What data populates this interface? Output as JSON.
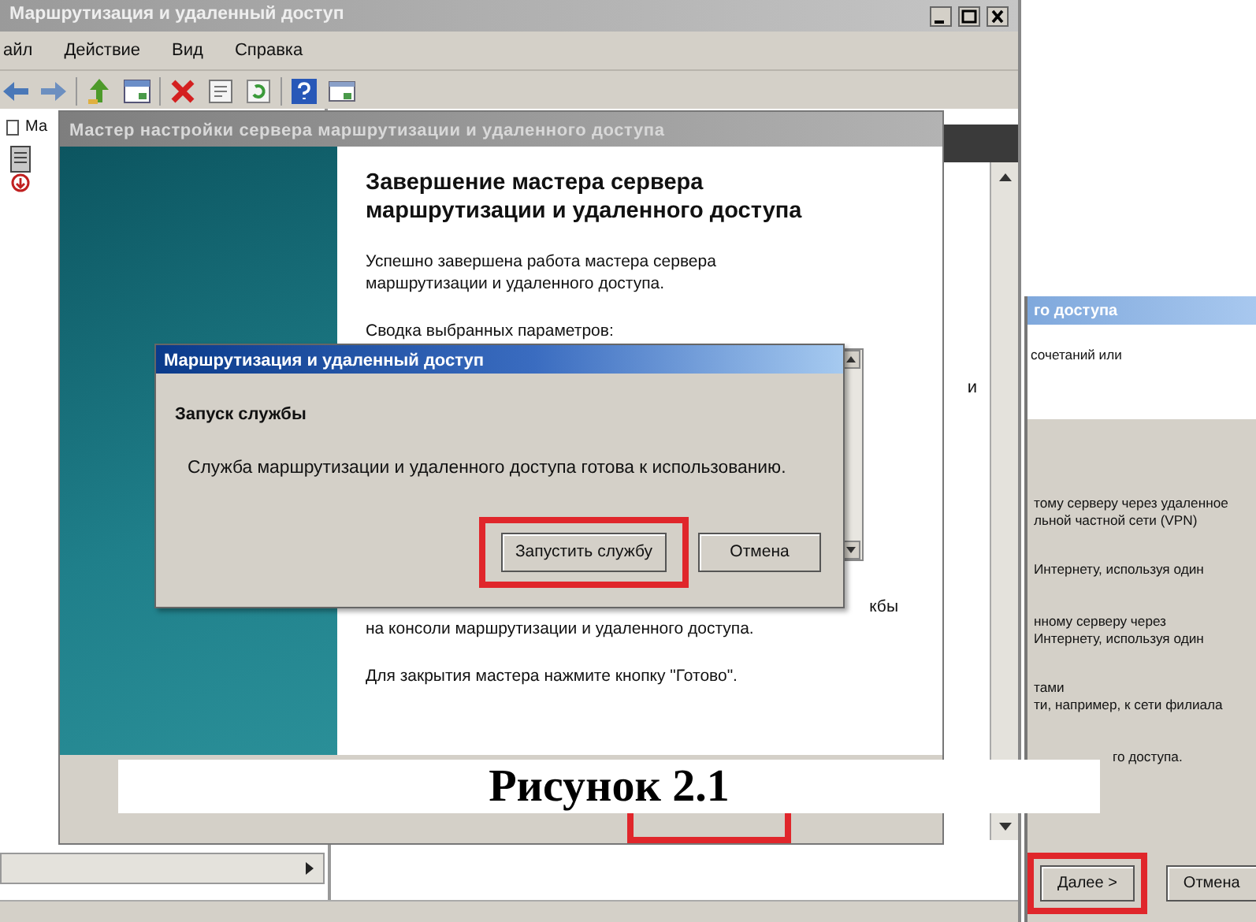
{
  "main_window": {
    "title": "Маршрутизация и удаленный доступ",
    "menu": [
      "айл",
      "Действие",
      "Вид",
      "Справка"
    ],
    "tree_item": "Ма",
    "pane_text": "и"
  },
  "back_wizard": {
    "title": "го доступа",
    "header_text": "сочетаний или",
    "lines": [
      "тому серверу через удаленное",
      "льной частной сети (VPN)",
      "Интернету, используя один",
      "нному серверу через",
      "Интернету, используя один",
      "тами",
      "ти, например, к сети филиала",
      "го доступа."
    ],
    "buttons": [
      {
        "label": "Далее >",
        "highlighted": true
      },
      {
        "label": "Отмена",
        "highlighted": false
      }
    ]
  },
  "wizard": {
    "title": "Мастер настройки сервера маршрутизации и удаленного доступа",
    "heading": "Завершение мастера сервера маршрутизации и удаленного доступа",
    "intro": "Успешно завершена работа мастера сервера маршрутизации и удаленного доступа.",
    "summary_label": "Сводка выбранных параметров:",
    "cut_text": "кбы",
    "console_text": "на консоли маршрутизации и удаленного доступа.",
    "close_hint": "Для закрытия мастера нажмите кнопку \"Готово\".",
    "finish_highlighted": true
  },
  "dialog": {
    "title": "Маршрутизация и удаленный доступ",
    "heading": "Запуск службы",
    "message": "Служба маршрутизации и удаленного доступа готова к использованию.",
    "buttons": [
      {
        "label": "Запустить службу",
        "highlighted": true
      },
      {
        "label": "Отмена",
        "highlighted": false
      }
    ]
  },
  "caption": "Рисунок 2.1"
}
